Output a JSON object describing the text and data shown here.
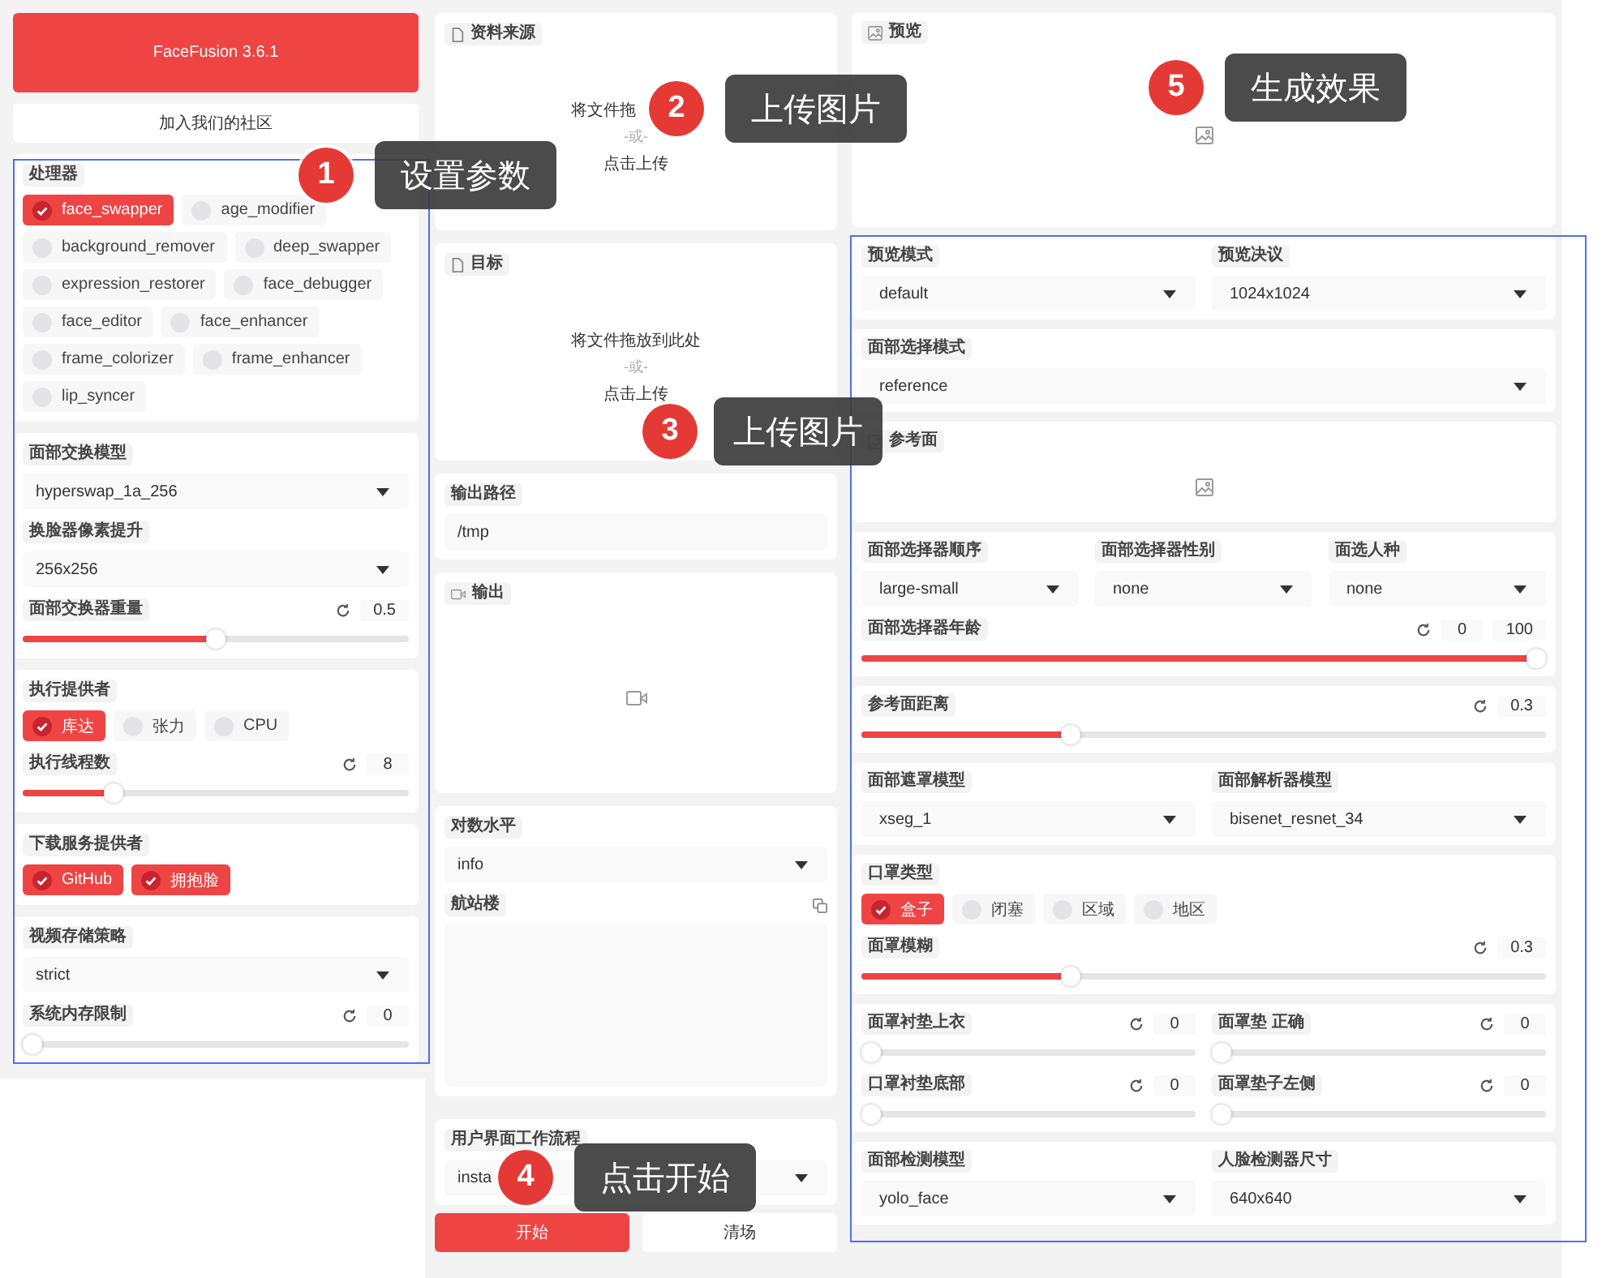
{
  "header": {
    "title": "FaceFusion 3.6.1",
    "community": "加入我们的社区"
  },
  "left_cards": [
    {
      "rows": [
        [
          {
            "kind": "checks",
            "label": "处理器",
            "options": [
              {
                "label": "face_swapper",
                "checked": true
              },
              {
                "label": "age_modifier",
                "checked": false
              },
              {
                "label": "background_remover",
                "checked": false
              },
              {
                "label": "deep_swapper",
                "checked": false
              },
              {
                "label": "expression_restorer",
                "checked": false
              },
              {
                "label": "face_debugger",
                "checked": false
              },
              {
                "label": "face_editor",
                "checked": false
              },
              {
                "label": "face_enhancer",
                "checked": false
              },
              {
                "label": "frame_colorizer",
                "checked": false
              },
              {
                "label": "frame_enhancer",
                "checked": false
              },
              {
                "label": "lip_syncer",
                "checked": false
              }
            ]
          }
        ]
      ]
    },
    {
      "rows": [
        [
          {
            "kind": "dropdown",
            "label": "面部交换模型",
            "value": "hyperswap_1a_256"
          }
        ],
        [
          {
            "kind": "dropdown",
            "label": "换脸器像素提升",
            "value": "256x256"
          }
        ],
        [
          {
            "kind": "slider",
            "label": "面部交换器重量",
            "value": "0.5",
            "level": 0.5
          }
        ]
      ]
    },
    {
      "rows": [
        [
          {
            "kind": "checks",
            "label": "执行提供者",
            "options": [
              {
                "label": "库达",
                "checked": true
              },
              {
                "label": "张力",
                "checked": false
              },
              {
                "label": "CPU",
                "checked": false
              }
            ]
          }
        ],
        [
          {
            "kind": "slider",
            "label": "执行线程数",
            "value": "8",
            "level": 0.22
          }
        ]
      ]
    },
    {
      "rows": [
        [
          {
            "kind": "checks",
            "label": "下载服务提供者",
            "options": [
              {
                "label": "GitHub",
                "checked": true
              },
              {
                "label": "拥抱脸",
                "checked": true
              }
            ]
          }
        ]
      ]
    },
    {
      "rows": [
        [
          {
            "kind": "dropdown",
            "label": "视频存储策略",
            "value": "strict"
          }
        ],
        [
          {
            "kind": "slider",
            "label": "系统内存限制",
            "value": "0",
            "level": 0
          }
        ]
      ]
    }
  ],
  "middle_cards": [
    {
      "rows": [
        [
          {
            "kind": "upload",
            "label": "资料来源",
            "hint": "将文件拖",
            "separator": "-或-",
            "action": "点击上传"
          }
        ]
      ]
    },
    {
      "rows": [
        [
          {
            "kind": "upload",
            "label": "目标",
            "hint": "将文件拖放到此处",
            "separator": "-或-",
            "action": "点击上传"
          }
        ]
      ]
    },
    {
      "rows": [
        [
          {
            "kind": "text",
            "label": "输出路径",
            "value": "/tmp"
          }
        ]
      ]
    },
    {
      "rows": [
        [
          {
            "kind": "media",
            "label": "输出"
          }
        ]
      ]
    },
    {
      "rows": [
        [
          {
            "kind": "dropdown",
            "label": "对数水平",
            "value": "info"
          }
        ],
        [
          {
            "kind": "log",
            "label": "航站楼"
          }
        ]
      ]
    },
    {
      "rows": [
        [
          {
            "kind": "dropdown",
            "label": "用户界面工作流程",
            "value": "insta"
          }
        ]
      ]
    }
  ],
  "actions": [
    {
      "label": "开始",
      "kind": "primary"
    },
    {
      "label": "清场",
      "kind": "secondary"
    }
  ],
  "right_cards": [
    {
      "rows": [
        [
          {
            "kind": "image",
            "label": "预览"
          }
        ]
      ]
    },
    {
      "rows": [
        [
          {
            "kind": "dropdown",
            "label": "预览模式",
            "value": "default"
          },
          {
            "kind": "dropdown",
            "label": "预览决议",
            "value": "1024x1024"
          }
        ]
      ]
    },
    {
      "rows": [
        [
          {
            "kind": "dropdown",
            "label": "面部选择模式",
            "value": "reference"
          }
        ]
      ]
    },
    {
      "rows": [
        [
          {
            "kind": "image",
            "label": "参考面"
          }
        ]
      ]
    },
    {
      "rows": [
        [
          {
            "kind": "dropdown",
            "label": "面部选择器顺序",
            "value": "large-small"
          },
          {
            "kind": "dropdown",
            "label": "面部选择器性别",
            "value": "none"
          },
          {
            "kind": "dropdown",
            "label": "面选人种",
            "value": "none"
          }
        ],
        [
          {
            "kind": "range",
            "label": "面部选择器年龄",
            "low": "0",
            "high": "100",
            "level": 1
          }
        ]
      ]
    },
    {
      "rows": [
        [
          {
            "kind": "slider",
            "label": "参考面距离",
            "value": "0.3",
            "level": 0.3
          }
        ]
      ]
    },
    {
      "rows": [
        [
          {
            "kind": "dropdown",
            "label": "面部遮罩模型",
            "value": "xseg_1"
          },
          {
            "kind": "dropdown",
            "label": "面部解析器模型",
            "value": "bisenet_resnet_34"
          }
        ]
      ]
    },
    {
      "rows": [
        [
          {
            "kind": "checks",
            "label": "口罩类型",
            "options": [
              {
                "label": "盒子",
                "checked": true
              },
              {
                "label": "闭塞",
                "checked": false
              },
              {
                "label": "区域",
                "checked": false
              },
              {
                "label": "地区",
                "checked": false
              }
            ]
          }
        ],
        [
          {
            "kind": "slider",
            "label": "面罩模糊",
            "value": "0.3",
            "level": 0.3
          }
        ]
      ]
    },
    {
      "rows": [
        [
          {
            "kind": "slider",
            "label": "面罩衬垫上衣",
            "value": "0",
            "level": 0
          },
          {
            "kind": "slider",
            "label": "面罩垫 正确",
            "value": "0",
            "level": 0
          }
        ],
        [
          {
            "kind": "slider",
            "label": "口罩衬垫底部",
            "value": "0",
            "level": 0
          },
          {
            "kind": "slider",
            "label": "面罩垫子左侧",
            "value": "0",
            "level": 0
          }
        ]
      ]
    },
    {
      "rows": [
        [
          {
            "kind": "dropdown",
            "label": "面部检测模型",
            "value": "yolo_face"
          },
          {
            "kind": "dropdown",
            "label": "人脸检测器尺寸",
            "value": "640x640"
          }
        ]
      ]
    }
  ],
  "annotations": [
    {
      "number": "1",
      "text": "设置参数"
    },
    {
      "number": "2",
      "text": "上传图片"
    },
    {
      "number": "3",
      "text": "上传图片"
    },
    {
      "number": "4",
      "text": "点击开始"
    },
    {
      "number": "5",
      "text": "生成效果"
    }
  ]
}
